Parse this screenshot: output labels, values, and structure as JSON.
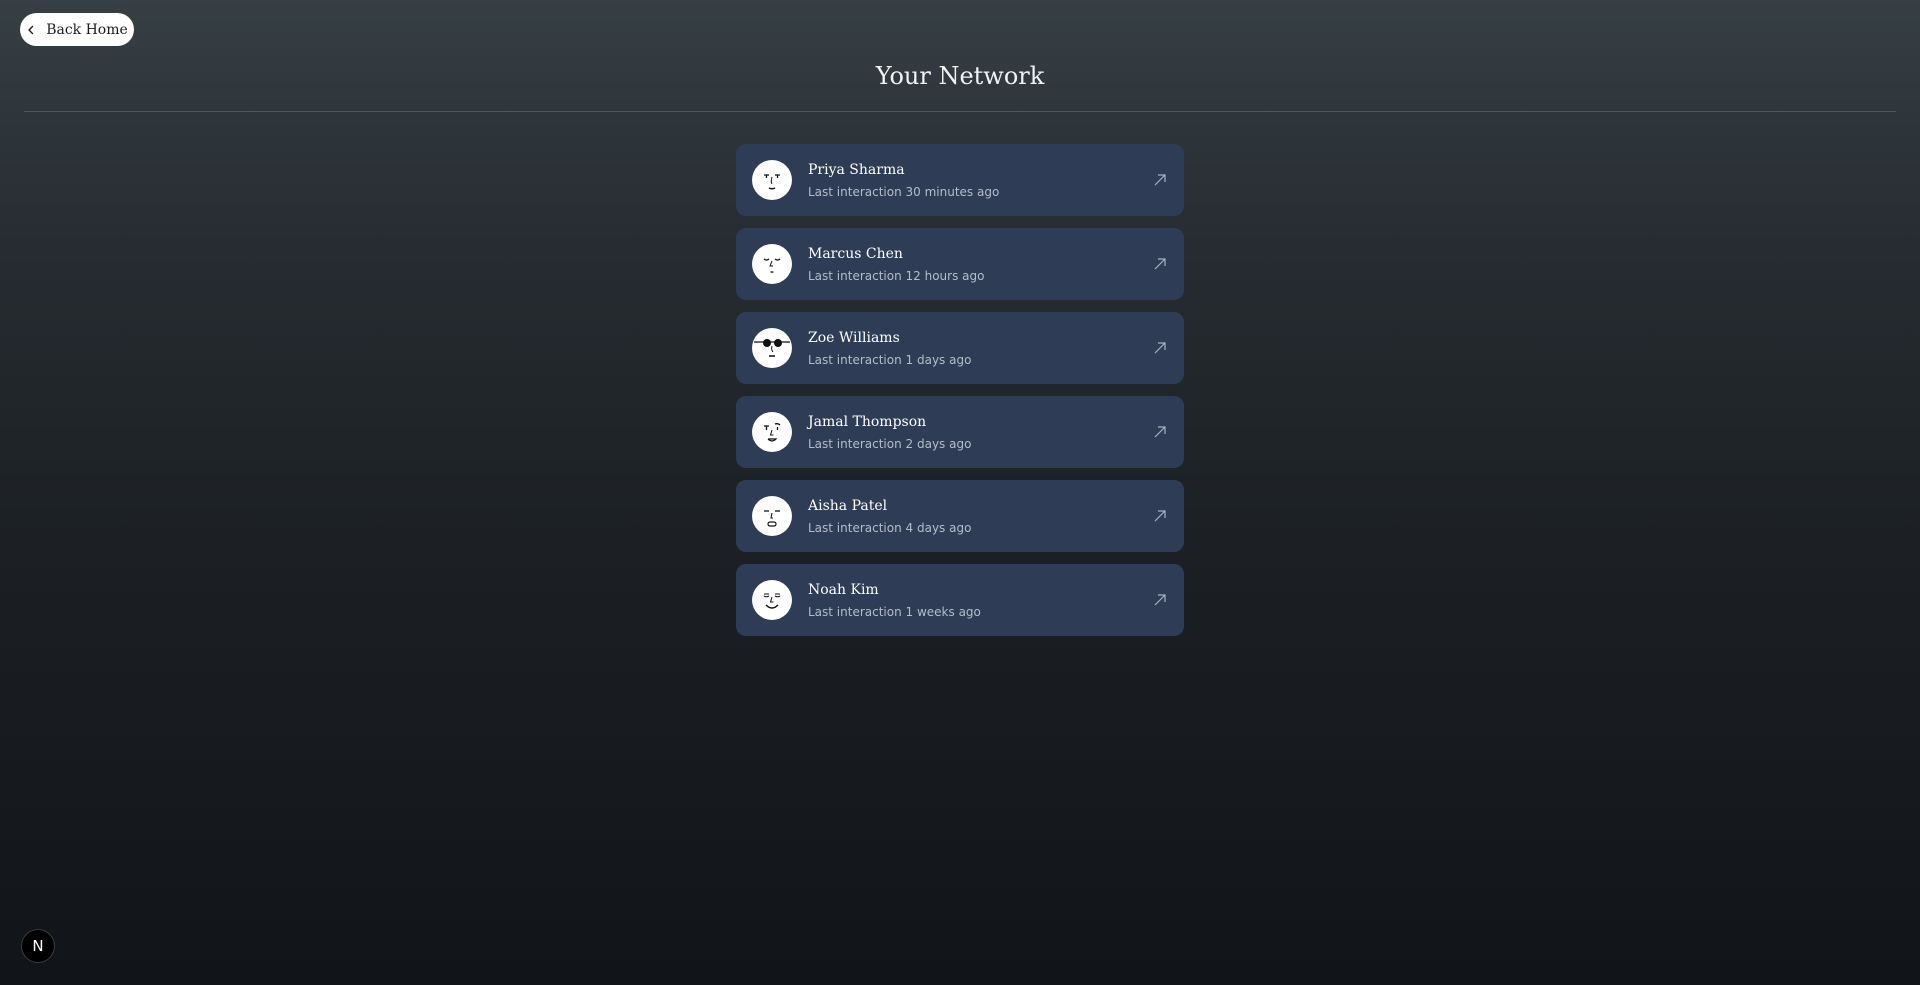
{
  "header": {
    "back_label": "Back Home",
    "title": "Your Network"
  },
  "contacts": [
    {
      "name": "Priya Sharma",
      "last": "Last interaction 30 minutes ago",
      "avatar": "face-neutral"
    },
    {
      "name": "Marcus Chen",
      "last": "Last interaction 12 hours ago",
      "avatar": "face-sleepy"
    },
    {
      "name": "Zoe Williams",
      "last": "Last interaction 1 days ago",
      "avatar": "face-sunglasses"
    },
    {
      "name": "Jamal Thompson",
      "last": "Last interaction 2 days ago",
      "avatar": "face-raised-brow"
    },
    {
      "name": "Aisha Patel",
      "last": "Last interaction 4 days ago",
      "avatar": "face-calm"
    },
    {
      "name": "Noah Kim",
      "last": "Last interaction 1 weeks ago",
      "avatar": "face-smile"
    }
  ],
  "badge": {
    "label": "N"
  },
  "colors": {
    "card": "#2e3d55",
    "subtext": "#b4bcc8",
    "background_top": "#363f44",
    "background_bottom": "#111418"
  }
}
